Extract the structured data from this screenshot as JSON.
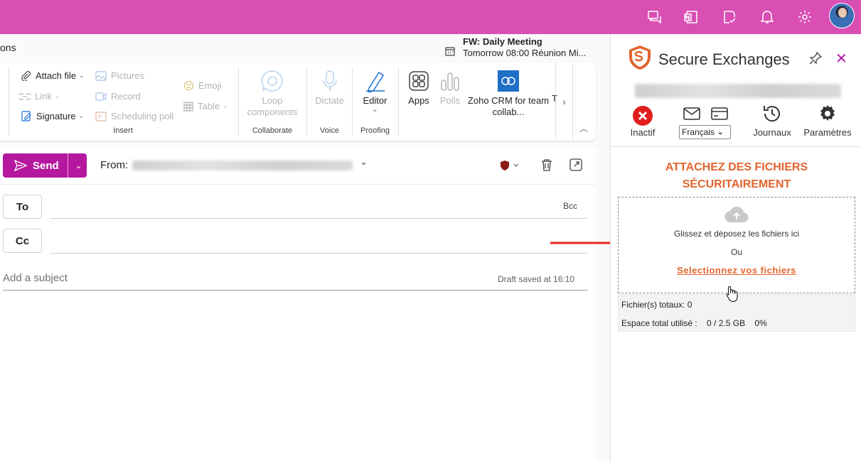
{
  "colors": {
    "topbar": "#d94fb4",
    "send": "#b5179e",
    "accent_orange": "#e2642d",
    "arrow": "#e8261c"
  },
  "topbar": {
    "icons": [
      "chat-icon",
      "onenote-icon",
      "tasks-icon",
      "bell-icon",
      "gear-icon"
    ]
  },
  "main": {
    "tab_partial": "ons"
  },
  "meeting": {
    "title": "FW: Daily Meeting",
    "subtitle": "Tomorrow 08:00 Réunion Mi..."
  },
  "ribbon": {
    "insert": {
      "attach_file": "Attach file",
      "link": "Link",
      "signature": "Signature",
      "pictures": "Pictures",
      "record": "Record",
      "scheduling_poll": "Scheduling poll",
      "emoji": "Emoji",
      "table": "Table",
      "group_label": "Insert"
    },
    "collaborate": {
      "loop": "Loop components",
      "group_label": "Collaborate"
    },
    "voice": {
      "dictate": "Dictate",
      "group_label": "Voice"
    },
    "proofing": {
      "editor": "Editor",
      "group_label": "Proofing"
    },
    "apps": {
      "apps": "Apps",
      "polls": "Polls",
      "zoho": "Zoho CRM for team collab...",
      "cutoff": "T"
    }
  },
  "compose": {
    "send_label": "Send",
    "from_label": "From:",
    "to_label": "To",
    "cc_label": "Cc",
    "bcc_label": "Bcc",
    "subject_placeholder": "Add a subject",
    "draft_status": "Draft saved at 16:10"
  },
  "panel": {
    "title": "Secure Exchanges",
    "tools": {
      "inactive": "Inactif",
      "language": "Français",
      "journals": "Journaux",
      "settings": "Paramètres"
    },
    "attach_title_line1": "ATTACHEZ DES FICHIERS",
    "attach_title_line2": "SÉCURITAIREMENT",
    "drop_text": "Glissez et déposez les fichiers ici",
    "or_text": "Ou",
    "select_link": "Selectionnez vos fichiers",
    "total_files": "Fichier(s) totaux: 0",
    "space_used": "Espace total utilisé :    0 / 2.5 GB    0%"
  }
}
